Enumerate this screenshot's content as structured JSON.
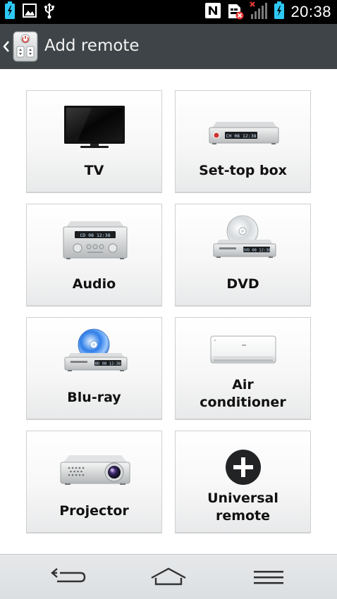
{
  "status_bar": {
    "time": "20:38",
    "icons_left": [
      "battery-charging-icon",
      "image-icon",
      "usb-icon"
    ],
    "icons_right": [
      "nfc-icon",
      "sim-error-icon",
      "signal-off-icon",
      "battery-charging-icon"
    ]
  },
  "action_bar": {
    "title": "Add remote",
    "back_icon": "chevron-left-icon",
    "app_icon": "remote-app-icon"
  },
  "tiles": [
    {
      "label": "TV",
      "icon": "tv-icon"
    },
    {
      "label": "Set-top box",
      "icon": "set-top-box-icon"
    },
    {
      "label": "Audio",
      "icon": "audio-icon"
    },
    {
      "label": "DVD",
      "icon": "dvd-icon"
    },
    {
      "label": "Blu-ray",
      "icon": "blu-ray-icon"
    },
    {
      "label_line1": "Air",
      "label_line2": "conditioner",
      "icon": "air-conditioner-icon"
    },
    {
      "label": "Projector",
      "icon": "projector-icon"
    },
    {
      "label_line1": "Universal",
      "label_line2": "remote",
      "icon": "plus-icon"
    }
  ],
  "device_displays": {
    "set_top_box": "CH 08  12:38",
    "audio": "CD 08  12:38",
    "dvd": "DVD 08  12:38",
    "blu_ray": "BD 08  12:38"
  },
  "nav_bar": {
    "icons": [
      "back-icon",
      "home-icon",
      "menu-icon"
    ]
  },
  "colors": {
    "action_bar": "#3e4447",
    "status_bar": "#000000",
    "nfc_badge": "#ffffff",
    "battery": "#2ec8f5",
    "nav_bar": "#e2e5e7"
  }
}
